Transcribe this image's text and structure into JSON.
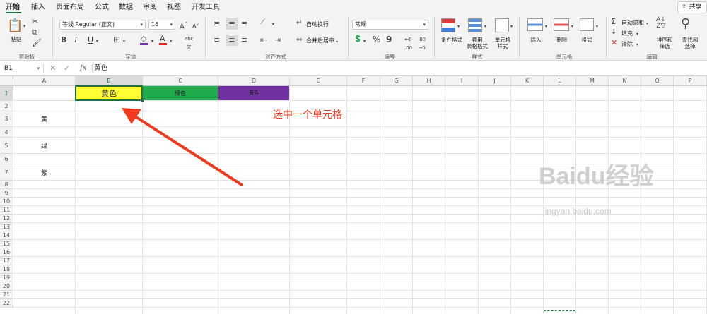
{
  "tabs": [
    "开始",
    "插入",
    "页面布局",
    "公式",
    "数据",
    "审阅",
    "视图",
    "开发工具"
  ],
  "share_label": "共享",
  "clipboard": {
    "paste_label": "粘贴",
    "group_label": "剪贴板"
  },
  "font": {
    "name": "等线 Regular (正文)",
    "size": "16",
    "group_label": "字体",
    "bold": "B",
    "italic": "I",
    "underline": "U",
    "grow": "A",
    "shrink": "A"
  },
  "alignment": {
    "wrap_label": "自动换行",
    "merge_label": "合并后居中",
    "group_label": "对齐方式"
  },
  "number": {
    "format": "常规",
    "group_label": "编号",
    "percent": "%",
    "comma": "9"
  },
  "styles": {
    "cond_format": "条件格式",
    "table_format_1": "套用",
    "table_format_2": "表格格式",
    "cell_style_1": "单元格",
    "cell_style_2": "样式",
    "group_label": "样式"
  },
  "cells": {
    "insert": "插入",
    "delete": "删除",
    "format": "格式",
    "group_label": "单元格"
  },
  "editing": {
    "autosum": "自动求和",
    "fill": "填充",
    "clear": "清除",
    "sort_1": "排序和",
    "sort_2": "筛选",
    "find_1": "查找和",
    "find_2": "选择",
    "group_label": "编辑"
  },
  "formula_bar": {
    "name_box": "B1",
    "fx": "fx",
    "content": "黄色"
  },
  "columns": [
    "A",
    "B",
    "C",
    "D",
    "E",
    "F",
    "G",
    "H",
    "I",
    "J",
    "K",
    "L",
    "M",
    "N",
    "O",
    "P"
  ],
  "rows": [
    "1",
    "2",
    "3",
    "4",
    "5",
    "6",
    "7",
    "8",
    "9",
    "10",
    "11",
    "12",
    "13",
    "14",
    "15",
    "16",
    "17",
    "18",
    "19",
    "20",
    "21",
    "22"
  ],
  "cell_values": {
    "B1": "黄色",
    "C1": "绿色",
    "D1": "黄色",
    "A3": "黄",
    "A5": "绿",
    "A7": "紫"
  },
  "annotation": "选中一个单元格",
  "watermark": {
    "brand": "Baidu经验",
    "url": "jingyan.baidu.com"
  },
  "colors": {
    "accent": "#1e7145",
    "yellow": "#ffff33",
    "green": "#1faa4c",
    "purple": "#7030a0",
    "annotation": "#ef3a1d"
  }
}
